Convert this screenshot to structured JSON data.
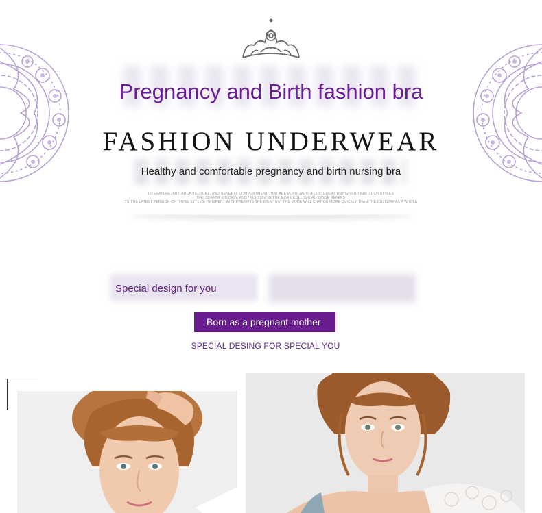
{
  "header": {
    "icon": "crown-icon",
    "headline": "Pregnancy and Birth fashion bra",
    "subheading": "FASHION UNDERWEAR",
    "tagline": "Healthy and comfortable pregnancy and birth nursing bra",
    "fine_print": [
      "LITERATURE, ART, ARCHITECTURE, AND GENERAL COMPORTMENT THAT ARE POPULAR IN A CULTURE AT ANY GIVEN TIME. SUCH STYLES",
      "MAY CHANGE QUICKLY, AND \"FASHION\" IN THE MORE COLLOQUIAL SENSE REFERS",
      "TO THE LATEST VERSION OF THESE STYLES. INHERENT IN THE TERM IS THE IDEA THAT THE MODE WILL CHANGE MORE QUICKLY THAN THE CULTURE AS A WHOLE"
    ]
  },
  "section": {
    "label": "Special design for you",
    "button_label": "Born as a pregnant mother",
    "caption": "SPECIAL DESING FOR SPECIAL YOU"
  },
  "colors": {
    "accent_purple": "#6a1d95",
    "button_bg": "#6a1d8f",
    "lace_lavender": "#b9a2d6"
  }
}
